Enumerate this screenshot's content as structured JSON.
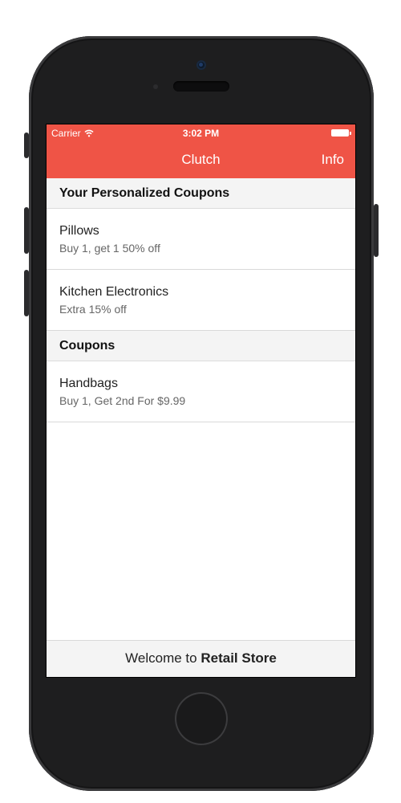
{
  "status_bar": {
    "carrier": "Carrier",
    "time": "3:02 PM",
    "wifi_icon": "wifi-icon",
    "battery_icon": "battery-icon"
  },
  "navbar": {
    "title": "Clutch",
    "right_button": "Info"
  },
  "sections": [
    {
      "header": "Your Personalized Coupons",
      "items": [
        {
          "title": "Pillows",
          "subtitle": "Buy 1, get 1 50% off"
        },
        {
          "title": "Kitchen Electronics",
          "subtitle": "Extra 15% off"
        }
      ]
    },
    {
      "header": "Coupons",
      "items": [
        {
          "title": "Handbags",
          "subtitle": "Buy 1, Get 2nd For $9.99"
        }
      ]
    }
  ],
  "footer": {
    "prefix": "Welcome to ",
    "store": "Retail Store"
  },
  "colors": {
    "accent": "#ef5446",
    "phone_body": "#1e1e1f"
  }
}
